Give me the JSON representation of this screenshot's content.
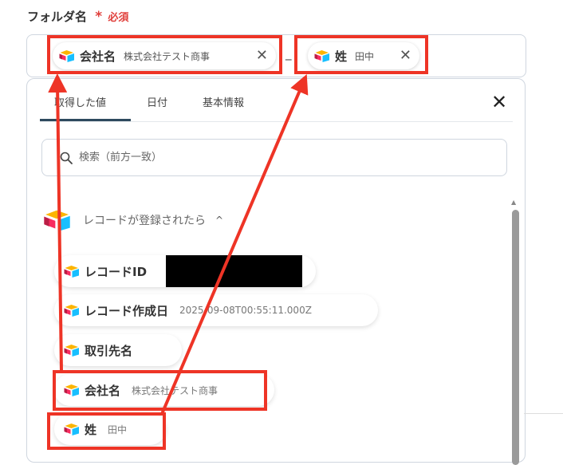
{
  "field": {
    "label": "フォルダ名",
    "required_mark": "*",
    "required_text": "必須"
  },
  "chips": [
    {
      "name": "会社名",
      "value": "株式会社テスト商事",
      "remove": "✕"
    },
    {
      "name": "姓",
      "value": "田中",
      "remove": "✕"
    }
  ],
  "separator": "_",
  "panel": {
    "tabs": [
      "取得した値",
      "日付",
      "基本情報"
    ],
    "active_tab": "取得した値",
    "close": "✕",
    "search": {
      "placeholder": "検索（前方一致）"
    },
    "group": {
      "title": "レコードが登録されたら",
      "chevron": "^"
    },
    "items": [
      {
        "label": "レコードID",
        "value": ""
      },
      {
        "label": "レコード作成日",
        "value": "2025-09-08T00:55:11.000Z"
      },
      {
        "label": "取引先名",
        "value": ""
      },
      {
        "label": "会社名",
        "value": "株式会社テスト商事"
      },
      {
        "label": "姓",
        "value": "田中"
      }
    ]
  },
  "colors": {
    "required": "#e0403c",
    "annotation": "#ee3426",
    "tab_underline": "#2e4a5e",
    "scroll_thumb": "#9a9a9a"
  },
  "icons": {
    "app": "airtable-icon",
    "search": "search-icon",
    "close": "close-icon"
  }
}
